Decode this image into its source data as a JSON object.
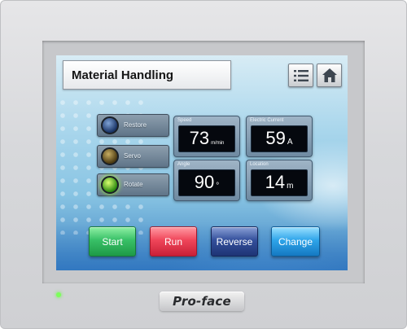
{
  "header": {
    "title": "Material Handling",
    "menu_icon": "list-icon",
    "home_icon": "home-icon"
  },
  "indicators": [
    {
      "label": "Restore",
      "lamp": "blue"
    },
    {
      "label": "Servo",
      "lamp": "amber"
    },
    {
      "label": "Rotate",
      "lamp": "green"
    }
  ],
  "readouts": {
    "speed": {
      "label": "Speed",
      "value": "73",
      "unit": "m/min"
    },
    "current": {
      "label": "Electric Current",
      "value": "59",
      "unit": "A"
    },
    "angle": {
      "label": "Angle",
      "value": "90",
      "unit": "°"
    },
    "location": {
      "label": "Location",
      "value": "14",
      "unit": "m"
    }
  },
  "actions": {
    "start": "Start",
    "run": "Run",
    "reverse": "Reverse",
    "change": "Change"
  },
  "device": {
    "brand": "Pro-face"
  },
  "colors": {
    "start": "#38c067",
    "run": "#f0465a",
    "reverse": "#34509c",
    "change": "#2fa5ea",
    "power_led": "#7cff5a"
  }
}
